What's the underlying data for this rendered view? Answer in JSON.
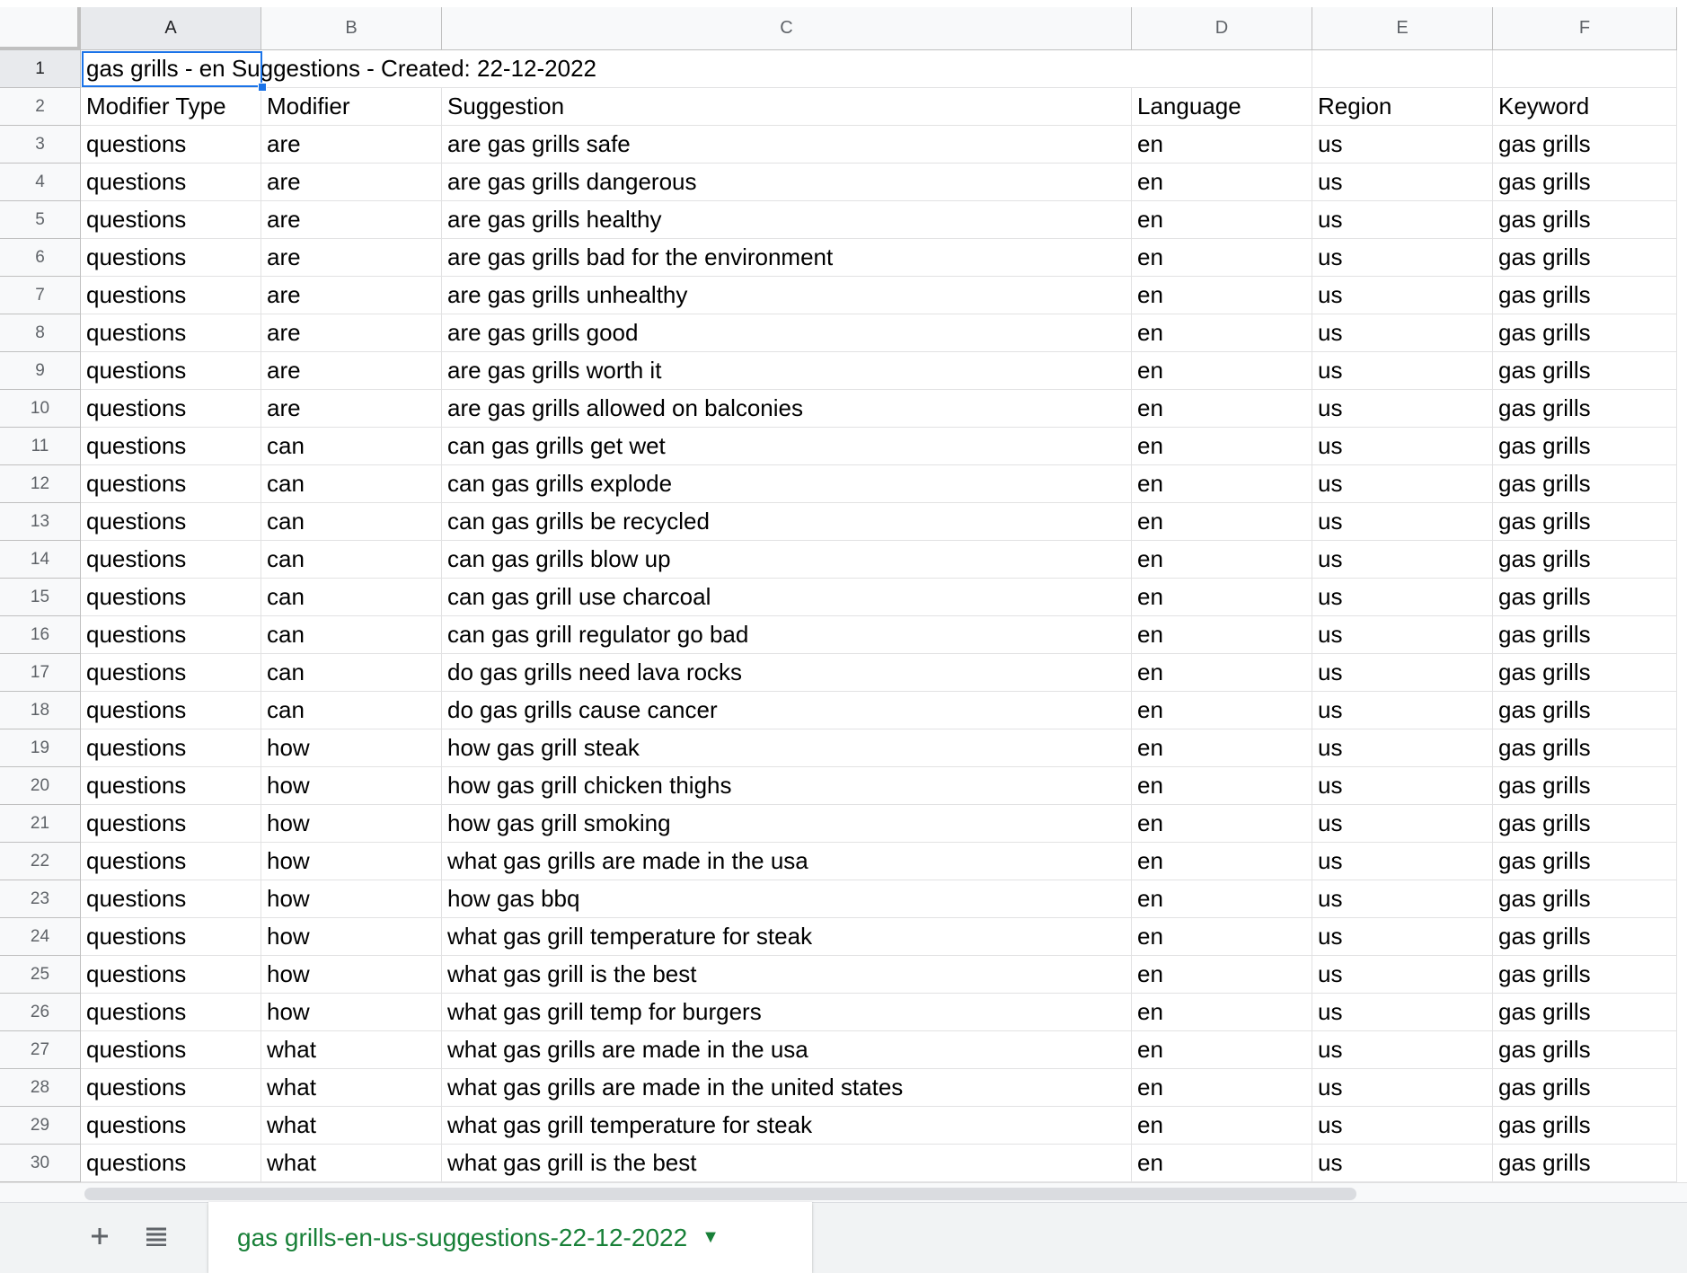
{
  "columns": [
    "A",
    "B",
    "C",
    "D",
    "E",
    "F"
  ],
  "active_column": "A",
  "active_row": "1",
  "title_cell": "gas grills - en Suggestions - Created: 22-12-2022",
  "header_row": [
    "Modifier Type",
    "Modifier",
    "Suggestion",
    "Language",
    "Region",
    "Keyword"
  ],
  "data_rows": [
    [
      "questions",
      "are",
      "are gas grills safe",
      "en",
      "us",
      "gas grills"
    ],
    [
      "questions",
      "are",
      "are gas grills dangerous",
      "en",
      "us",
      "gas grills"
    ],
    [
      "questions",
      "are",
      "are gas grills healthy",
      "en",
      "us",
      "gas grills"
    ],
    [
      "questions",
      "are",
      "are gas grills bad for the environment",
      "en",
      "us",
      "gas grills"
    ],
    [
      "questions",
      "are",
      "are gas grills unhealthy",
      "en",
      "us",
      "gas grills"
    ],
    [
      "questions",
      "are",
      "are gas grills good",
      "en",
      "us",
      "gas grills"
    ],
    [
      "questions",
      "are",
      "are gas grills worth it",
      "en",
      "us",
      "gas grills"
    ],
    [
      "questions",
      "are",
      "are gas grills allowed on balconies",
      "en",
      "us",
      "gas grills"
    ],
    [
      "questions",
      "can",
      "can gas grills get wet",
      "en",
      "us",
      "gas grills"
    ],
    [
      "questions",
      "can",
      "can gas grills explode",
      "en",
      "us",
      "gas grills"
    ],
    [
      "questions",
      "can",
      "can gas grills be recycled",
      "en",
      "us",
      "gas grills"
    ],
    [
      "questions",
      "can",
      "can gas grills blow up",
      "en",
      "us",
      "gas grills"
    ],
    [
      "questions",
      "can",
      "can gas grill use charcoal",
      "en",
      "us",
      "gas grills"
    ],
    [
      "questions",
      "can",
      "can gas grill regulator go bad",
      "en",
      "us",
      "gas grills"
    ],
    [
      "questions",
      "can",
      "do gas grills need lava rocks",
      "en",
      "us",
      "gas grills"
    ],
    [
      "questions",
      "can",
      "do gas grills cause cancer",
      "en",
      "us",
      "gas grills"
    ],
    [
      "questions",
      "how",
      "how gas grill steak",
      "en",
      "us",
      "gas grills"
    ],
    [
      "questions",
      "how",
      "how gas grill chicken thighs",
      "en",
      "us",
      "gas grills"
    ],
    [
      "questions",
      "how",
      "how gas grill smoking",
      "en",
      "us",
      "gas grills"
    ],
    [
      "questions",
      "how",
      "what gas grills are made in the usa",
      "en",
      "us",
      "gas grills"
    ],
    [
      "questions",
      "how",
      "how gas bbq",
      "en",
      "us",
      "gas grills"
    ],
    [
      "questions",
      "how",
      "what gas grill temperature for steak",
      "en",
      "us",
      "gas grills"
    ],
    [
      "questions",
      "how",
      "what gas grill is the best",
      "en",
      "us",
      "gas grills"
    ],
    [
      "questions",
      "how",
      "what gas grill temp for burgers",
      "en",
      "us",
      "gas grills"
    ],
    [
      "questions",
      "what",
      "what gas grills are made in the usa",
      "en",
      "us",
      "gas grills"
    ],
    [
      "questions",
      "what",
      "what gas grills are made in the united states",
      "en",
      "us",
      "gas grills"
    ],
    [
      "questions",
      "what",
      "what gas grill temperature for steak",
      "en",
      "us",
      "gas grills"
    ],
    [
      "questions",
      "what",
      "what gas grill is the best",
      "en",
      "us",
      "gas grills"
    ]
  ],
  "tab_bar": {
    "add_sheet_icon": "plus-icon",
    "all_sheets_icon": "list-icon",
    "sheet_tab_label": "gas grills-en-us-suggestions-22-12-2022",
    "dropdown_icon": "caret-down-icon"
  },
  "colors": {
    "selection": "#1a73e8",
    "sheet_tab_text": "#188038",
    "header_bg": "#f8f9fa"
  }
}
